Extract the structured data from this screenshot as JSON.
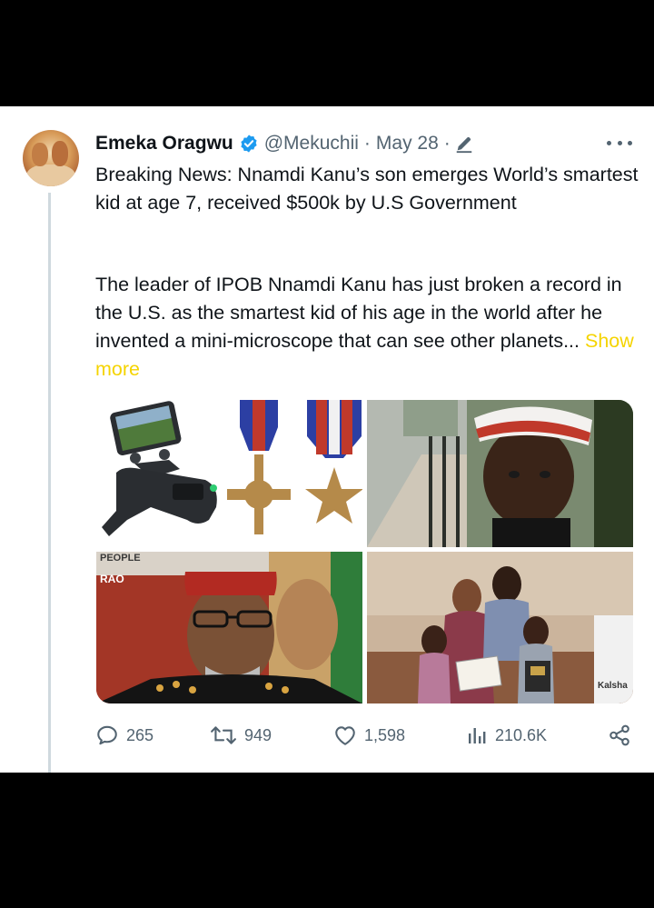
{
  "tweet": {
    "author_name": "Emeka Oragwu",
    "handle": "@Mekuchii",
    "separator": "·",
    "date": "May 28",
    "body_line1": "Breaking News: Nnamdi Kanu’s son emerges World’s smartest kid at age 7, received $500k by U.S Government",
    "body_line2": "The leader of IPOB Nnamdi Kanu has just broken a record in the U.S. as the smartest kid of his age in the world after he invented a mini-microscope that can see other planets...",
    "show_more": "Show more"
  },
  "images": {
    "bottom_left_banner_text_top": "PEOPLE",
    "bottom_left_banner_text": "RAO",
    "award_sign": "Kalsha"
  },
  "actions": {
    "replies": "265",
    "retweets": "949",
    "likes": "1,598",
    "views": "210.6K"
  },
  "colors": {
    "verified": "#1d9bf0",
    "show_more": "#f5d400",
    "secondary_text": "#536471"
  }
}
